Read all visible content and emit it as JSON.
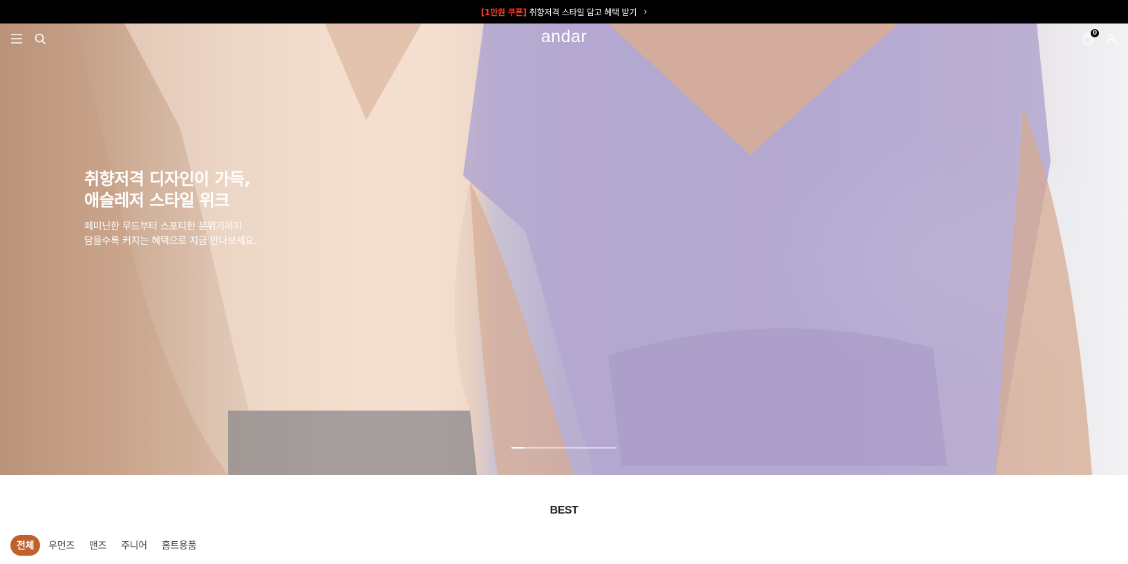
{
  "promo": {
    "tag": "[1만원 쿠폰]",
    "text": "취향저격 스타일 담고 혜택 받기",
    "arrow": "›"
  },
  "header": {
    "logo": "andar",
    "menu_icon": "hamburger-menu-icon",
    "search_icon": "search-icon",
    "cart_icon": "shopping-bag-icon",
    "cart_count": "0",
    "account_icon": "user-icon"
  },
  "hero": {
    "title": "취향저격 디자인이 가득,\n애슬레저 스타일 위크",
    "subtitle": "페미닌한 무드부터 스포티한 분위기까지\n담을수록 커지는 혜택으로 지금 만나보세요.",
    "slide_progress": 0.12
  },
  "best": {
    "title": "BEST",
    "tabs": [
      {
        "label": "전체",
        "active": true
      },
      {
        "label": "우먼즈",
        "active": false
      },
      {
        "label": "맨즈",
        "active": false
      },
      {
        "label": "주니어",
        "active": false
      },
      {
        "label": "홈트용품",
        "active": false
      }
    ]
  },
  "colors": {
    "promo_bg": "#000000",
    "promo_accent": "#ff3b1f",
    "active_tab": "#c0602a"
  }
}
